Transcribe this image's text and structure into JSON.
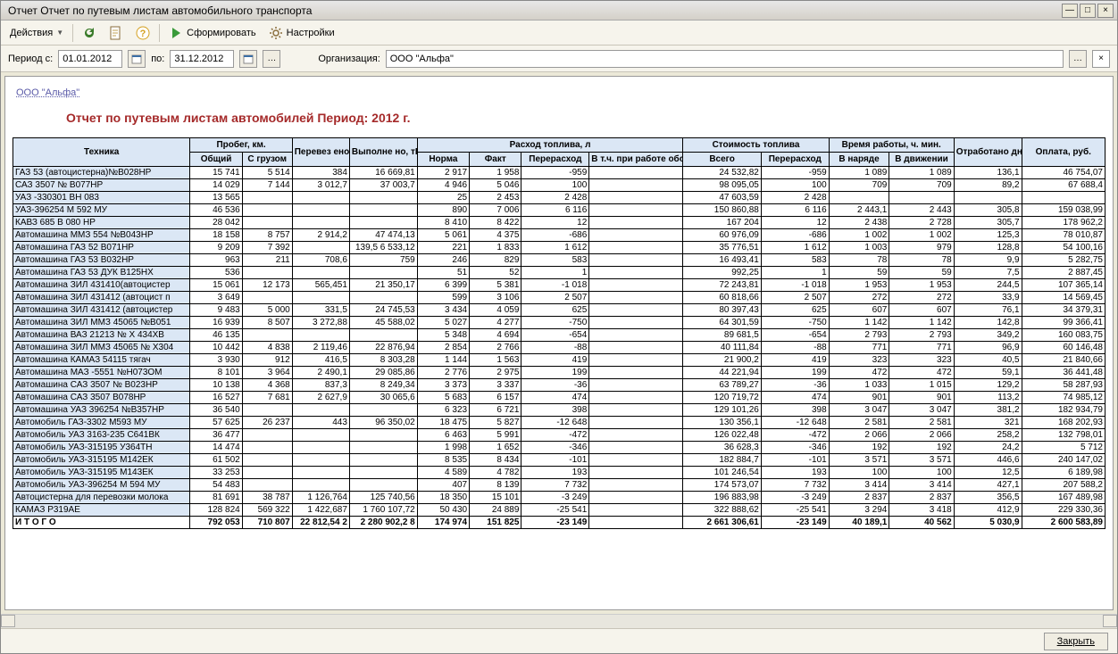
{
  "window": {
    "title": "Отчет  Отчет по путевым листам автомобильного транспорта"
  },
  "toolbar": {
    "actions": "Действия",
    "form": "Сформировать",
    "settings": "Настройки"
  },
  "params": {
    "period_label": "Период с:",
    "date_from": "01.01.2012",
    "to_label": "по:",
    "date_to": "31.12.2012",
    "org_label": "Организация:",
    "org_value": "ООО \"Альфа\""
  },
  "report": {
    "org_link": "ООО \"Альфа\"",
    "title": "Отчет по путевым листам автомобилей  Период: 2012 г.",
    "headers": {
      "tech": "Техника",
      "run_group": "Пробег, км.",
      "run_total": "Общий",
      "run_cargo": "С грузом",
      "transported": "Перевез ено, тн.",
      "done": "Выполне но, тКм",
      "fuel_group": "Расход топлива, л",
      "norm": "Норма",
      "fact": "Факт",
      "over": "Перерасход",
      "equip": "В т.ч. при работе оборудования",
      "cost_group": "Стоимость топлива",
      "cost_total": "Всего",
      "cost_over": "Перерасход",
      "time_group": "Время работы, ч. мин.",
      "time_order": "В наряде",
      "time_move": "В движении",
      "days": "Отработано дней",
      "pay": "Оплата, руб."
    },
    "rows": [
      {
        "name": "ГАЗ 53 (автоцистерна)№В028НР",
        "r": [
          "15 741",
          "5 514",
          "384",
          "16 669,81",
          "2 917",
          "1 958",
          "-959",
          "",
          "24 532,82",
          "-959",
          "1 089",
          "1 089",
          "136,1",
          "46 754,07"
        ]
      },
      {
        "name": "САЗ 3507  № В077НР",
        "r": [
          "14 029",
          "7 144",
          "3 012,7",
          "37 003,7",
          "4 946",
          "5 046",
          "100",
          "",
          "98 095,05",
          "100",
          "709",
          "709",
          "89,2",
          "67 688,4"
        ]
      },
      {
        "name": "УАЗ -330301 ВН 083",
        "r": [
          "13 565",
          "",
          "",
          "",
          "25",
          "2 453",
          "2 428",
          "",
          "47 603,59",
          "2 428",
          "",
          "",
          "",
          ""
        ]
      },
      {
        "name": "УАЗ-396254 М 592 МУ",
        "r": [
          "46 536",
          "",
          "",
          "",
          "890",
          "7 006",
          "6 116",
          "",
          "150 860,88",
          "6 116",
          "2 443,1",
          "2 443",
          "305,8",
          "159 038,99"
        ]
      },
      {
        "name": "КАВЗ 685  В 080 НР",
        "r": [
          "28 042",
          "",
          "",
          "",
          "8 410",
          "8 422",
          "12",
          "",
          "167 204",
          "12",
          "2 438",
          "2 728",
          "305,7",
          "178 962,2"
        ]
      },
      {
        "name": "Автомашина  ММЗ 554  №В043НР",
        "r": [
          "18 158",
          "8 757",
          "2 914,2",
          "47 474,13",
          "5 061",
          "4 375",
          "-686",
          "",
          "60 976,09",
          "-686",
          "1 002",
          "1 002",
          "125,3",
          "78 010,87"
        ]
      },
      {
        "name": "Автомашина  ГАЗ 52  В071НР",
        "r": [
          "9 209",
          "7 392",
          "",
          "139,5 6 533,12",
          "221",
          "1 833",
          "1 612",
          "",
          "35 776,51",
          "1 612",
          "1 003",
          "979",
          "128,8",
          "54 100,16"
        ]
      },
      {
        "name": "Автомашина  ГАЗ 53  В032НР",
        "r": [
          "963",
          "211",
          "708,6",
          "759",
          "246",
          "829",
          "583",
          "",
          "16 493,41",
          "583",
          "78",
          "78",
          "9,9",
          "5 282,75"
        ]
      },
      {
        "name": "Автомашина  ГАЗ 53  ДУК  В125НХ",
        "r": [
          "536",
          "",
          "",
          "",
          "51",
          "52",
          "1",
          "",
          "992,25",
          "1",
          "59",
          "59",
          "7,5",
          "2 887,45"
        ]
      },
      {
        "name": "Автомашина  ЗИЛ 431410(автоцистер",
        "r": [
          "15 061",
          "12 173",
          "565,451",
          "21 350,17",
          "6 399",
          "5 381",
          "-1 018",
          "",
          "72 243,81",
          "-1 018",
          "1 953",
          "1 953",
          "244,5",
          "107 365,14"
        ]
      },
      {
        "name": "Автомашина  ЗИЛ 431412 (автоцист п",
        "r": [
          "3 649",
          "",
          "",
          "",
          "599",
          "3 106",
          "2 507",
          "",
          "60 818,66",
          "2 507",
          "272",
          "272",
          "33,9",
          "14 569,45"
        ]
      },
      {
        "name": "Автомашина  ЗИЛ 431412 (автоцистер",
        "r": [
          "9 483",
          "5 000",
          "331,5",
          "24 745,53",
          "3 434",
          "4 059",
          "625",
          "",
          "80 397,43",
          "625",
          "607",
          "607",
          "76,1",
          "34 379,31"
        ]
      },
      {
        "name": "Автомашина  ЗИЛ ММЗ 45065 №В051",
        "r": [
          "16 939",
          "8 507",
          "3 272,88",
          "45 588,02",
          "5 027",
          "4 277",
          "-750",
          "",
          "64 301,59",
          "-750",
          "1 142",
          "1 142",
          "142,8",
          "99 366,41"
        ]
      },
      {
        "name": "Автомашина ВАЗ 21213 № Х 434ХВ",
        "r": [
          "46 135",
          "",
          "",
          "",
          "5 348",
          "4 694",
          "-654",
          "",
          "89 681,5",
          "-654",
          "2 793",
          "2 793",
          "349,2",
          "160 083,75"
        ]
      },
      {
        "name": "Автомашина ЗИЛ ММЗ 45065  № Х304",
        "r": [
          "10 442",
          "4 838",
          "2 119,46",
          "22 876,94",
          "2 854",
          "2 766",
          "-88",
          "",
          "40 111,84",
          "-88",
          "771",
          "771",
          "96,9",
          "60 146,48"
        ]
      },
      {
        "name": "Автомашина КАМАЗ 54115 тягач",
        "r": [
          "3 930",
          "912",
          "416,5",
          "8 303,28",
          "1 144",
          "1 563",
          "419",
          "",
          "21 900,2",
          "419",
          "323",
          "323",
          "40,5",
          "21 840,66"
        ]
      },
      {
        "name": "Автомашина МАЗ -5551  №Н073ОМ",
        "r": [
          "8 101",
          "3 964",
          "2 490,1",
          "29 085,86",
          "2 776",
          "2 975",
          "199",
          "",
          "44 221,94",
          "199",
          "472",
          "472",
          "59,1",
          "36 441,48"
        ]
      },
      {
        "name": "Автомашина САЗ 3507 № В023НР",
        "r": [
          "10 138",
          "4 368",
          "837,3",
          "8 249,34",
          "3 373",
          "3 337",
          "-36",
          "",
          "63 789,27",
          "-36",
          "1 033",
          "1 015",
          "129,2",
          "58 287,93"
        ]
      },
      {
        "name": "Автомашина САЗ 3507 В078НР",
        "r": [
          "16 527",
          "7 681",
          "2 627,9",
          "30 065,6",
          "5 683",
          "6 157",
          "474",
          "",
          "120 719,72",
          "474",
          "901",
          "901",
          "113,2",
          "74 985,12"
        ]
      },
      {
        "name": "Автомашина УАЗ 396254 №В357НР",
        "r": [
          "36 540",
          "",
          "",
          "",
          "6 323",
          "6 721",
          "398",
          "",
          "129 101,26",
          "398",
          "3 047",
          "3 047",
          "381,2",
          "182 934,79"
        ]
      },
      {
        "name": "Автомобиль ГАЗ-3302 М593 МУ",
        "r": [
          "57 625",
          "26 237",
          "443",
          "96 350,02",
          "18 475",
          "5 827",
          "-12 648",
          "",
          "130 356,1",
          "-12 648",
          "2 581",
          "2 581",
          "321",
          "168 202,93"
        ]
      },
      {
        "name": "Автомобиль УАЗ 3163-235 С641ВК",
        "r": [
          "36 477",
          "",
          "",
          "",
          "6 463",
          "5 991",
          "-472",
          "",
          "126 022,48",
          "-472",
          "2 066",
          "2 066",
          "258,2",
          "132 798,01"
        ]
      },
      {
        "name": "Автомобиль УАЗ-315195  У364ТН",
        "r": [
          "14 474",
          "",
          "",
          "",
          "1 998",
          "1 652",
          "-346",
          "",
          "36 628,3",
          "-346",
          "192",
          "192",
          "24,2",
          "5 712"
        ]
      },
      {
        "name": "Автомобиль УАЗ-315195 М142ЕК",
        "r": [
          "61 502",
          "",
          "",
          "",
          "8 535",
          "8 434",
          "-101",
          "",
          "182 884,7",
          "-101",
          "3 571",
          "3 571",
          "446,6",
          "240 147,02"
        ]
      },
      {
        "name": "Автомобиль УАЗ-315195 М143ЕК",
        "r": [
          "33 253",
          "",
          "",
          "",
          "4 589",
          "4 782",
          "193",
          "",
          "101 246,54",
          "193",
          "100",
          "100",
          "12,5",
          "6 189,98"
        ]
      },
      {
        "name": "Автомобиль УАЗ-396254  М 594 МУ",
        "r": [
          "54 483",
          "",
          "",
          "",
          "407",
          "8 139",
          "7 732",
          "",
          "174 573,07",
          "7 732",
          "3 414",
          "3 414",
          "427,1",
          "207 588,2"
        ]
      },
      {
        "name": "Автоцистерна для перевозки  молока",
        "r": [
          "81 691",
          "38 787",
          "1 126,764",
          "125 740,56",
          "18 350",
          "15 101",
          "-3 249",
          "",
          "196 883,98",
          "-3 249",
          "2 837",
          "2 837",
          "356,5",
          "167 489,98"
        ]
      },
      {
        "name": "КАМАЗ  Р319АЕ",
        "r": [
          "128 824",
          "569 322",
          "1 422,687",
          "1 760 107,72",
          "50 430",
          "24 889",
          "-25 541",
          "",
          "322 888,62",
          "-25 541",
          "3 294",
          "3 418",
          "412,9",
          "229 330,36"
        ]
      }
    ],
    "total": {
      "name": "И Т О Г О",
      "r": [
        "792 053",
        "710 807",
        "22 812,54 2",
        "2 280 902,2 8",
        "174 974",
        "151 825",
        "-23 149",
        "",
        "2 661 306,61",
        "-23 149",
        "40 189,1",
        "40 562",
        "5 030,9",
        "2 600 583,89"
      ]
    }
  },
  "footer": {
    "close": "Закрыть"
  }
}
